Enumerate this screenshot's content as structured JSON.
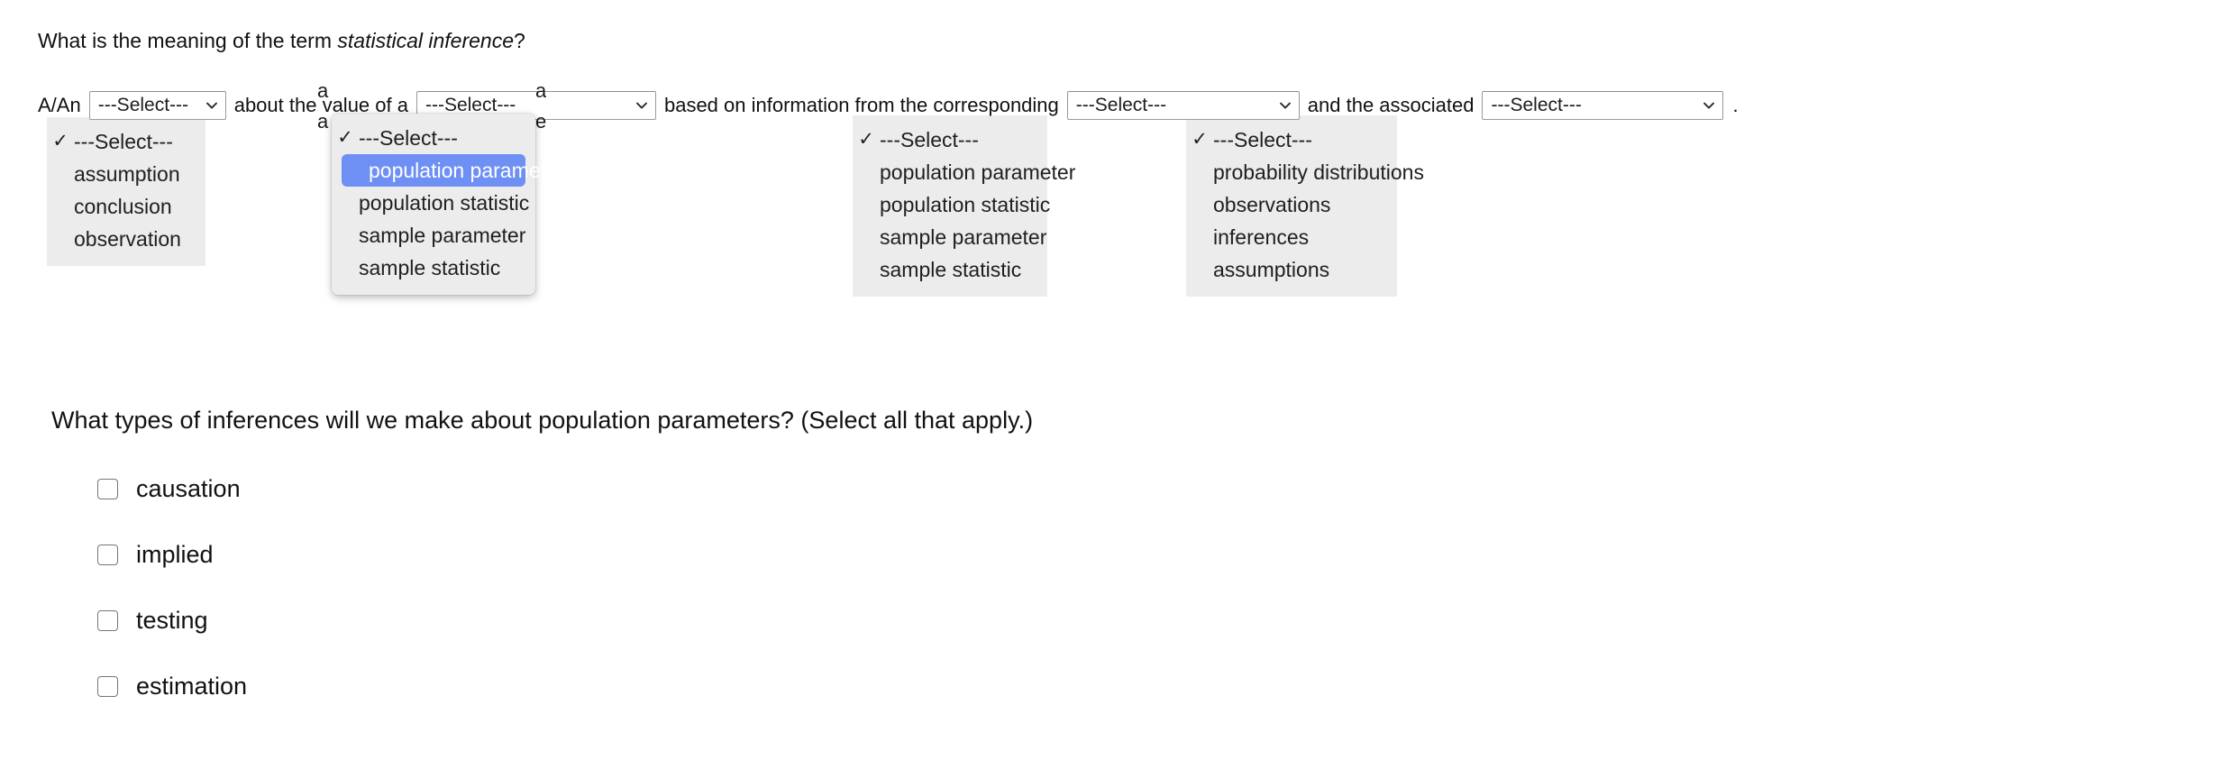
{
  "question1": {
    "prompt_before_em": "What is the meaning of the term ",
    "prompt_em": "statistical inference",
    "prompt_after_em": "?",
    "sentence": {
      "frag1": "A/An",
      "frag2": "about the value of a",
      "frag3": "based on information from the corresponding",
      "frag4": "and the associated",
      "frag5": "."
    },
    "selects": [
      {
        "name": "select-inference-type",
        "value": "---Select---",
        "chevron_icon": "chevron-down-icon",
        "open": true,
        "active": false,
        "options": [
          {
            "label": "---Select---",
            "checked": true,
            "highlighted": false
          },
          {
            "label": "assumption",
            "checked": false,
            "highlighted": false
          },
          {
            "label": "conclusion",
            "checked": false,
            "highlighted": false
          },
          {
            "label": "observation",
            "checked": false,
            "highlighted": false
          }
        ]
      },
      {
        "name": "select-target-quantity",
        "value": "---Select---",
        "chevron_icon": "chevron-down-icon",
        "open": true,
        "active": true,
        "options": [
          {
            "label": "---Select---",
            "checked": true,
            "highlighted": false
          },
          {
            "label": "population parameter",
            "checked": false,
            "highlighted": true
          },
          {
            "label": "population statistic",
            "checked": false,
            "highlighted": false
          },
          {
            "label": "sample parameter",
            "checked": false,
            "highlighted": false
          },
          {
            "label": "sample statistic",
            "checked": false,
            "highlighted": false
          }
        ]
      },
      {
        "name": "select-information-source",
        "value": "---Select---",
        "chevron_icon": "chevron-down-icon",
        "open": true,
        "active": false,
        "options": [
          {
            "label": "---Select---",
            "checked": true,
            "highlighted": false
          },
          {
            "label": "population parameter",
            "checked": false,
            "highlighted": false
          },
          {
            "label": "population statistic",
            "checked": false,
            "highlighted": false
          },
          {
            "label": "sample parameter",
            "checked": false,
            "highlighted": false
          },
          {
            "label": "sample statistic",
            "checked": false,
            "highlighted": false
          }
        ]
      },
      {
        "name": "select-associated-concept",
        "value": "---Select---",
        "chevron_icon": "chevron-down-icon",
        "open": true,
        "active": false,
        "options": [
          {
            "label": "---Select---",
            "checked": true,
            "highlighted": false
          },
          {
            "label": "probability distributions",
            "checked": false,
            "highlighted": false
          },
          {
            "label": "observations",
            "checked": false,
            "highlighted": false
          },
          {
            "label": "inferences",
            "checked": false,
            "highlighted": false
          },
          {
            "label": "assumptions",
            "checked": false,
            "highlighted": false
          }
        ]
      }
    ],
    "occluded_glyphs": [
      "a",
      "a",
      "a",
      "e"
    ]
  },
  "question2": {
    "prompt": "What types of inferences will we make about population parameters? (Select all that apply.)",
    "options": [
      {
        "label": "causation",
        "checked": false
      },
      {
        "label": "implied",
        "checked": false
      },
      {
        "label": "testing",
        "checked": false
      },
      {
        "label": "estimation",
        "checked": false
      }
    ]
  },
  "colors": {
    "highlight": "#6e8ff4",
    "popup_background": "#ececed",
    "text": "#111111",
    "page_background": "#ffffff"
  },
  "icons": {
    "checkmark": "✓",
    "chevron_down": "chevron-down-icon"
  }
}
